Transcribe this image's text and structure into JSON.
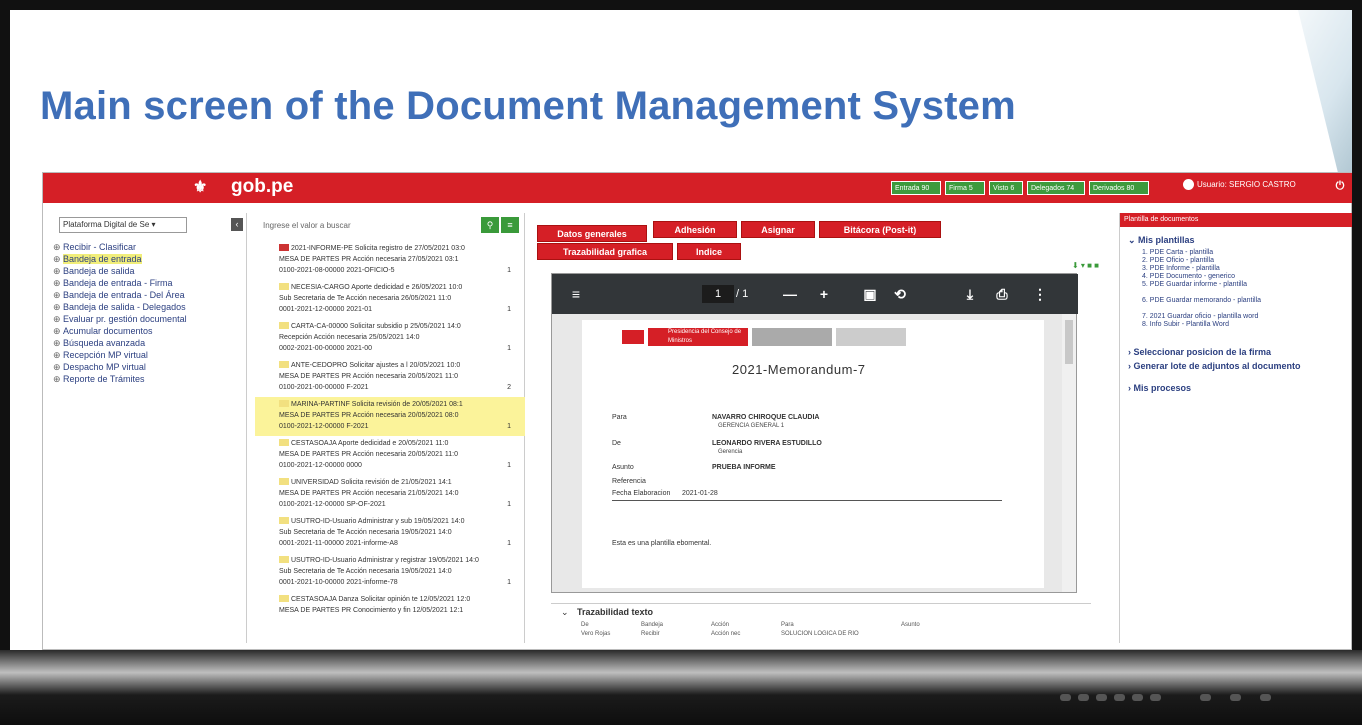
{
  "slide": {
    "headline": "Main screen of the Document Management System"
  },
  "topbar": {
    "brand": "gob.pe",
    "buttons": [
      "Entrada 90",
      "Firma 5",
      "Visto 6",
      "Delegados 74",
      "Derivados 80"
    ],
    "user": "Usuario: SERGIO CASTRO",
    "colors": {
      "bar": "#d51f26",
      "button": "#3d9a3d"
    }
  },
  "leftnav": {
    "platform_select": "Plataforma Digital de Se",
    "items": [
      "Recibir - Clasificar",
      "Bandeja de entrada",
      "Bandeja de salida",
      "Bandeja de entrada - Firma",
      "Bandeja de entrada - Del Área",
      "Bandeja de salida - Delegados",
      "Evaluar pr. gestión documental",
      "Acumular documentos",
      "Búsqueda avanzada",
      "Recepción MP virtual",
      "Despacho MP virtual",
      "Reporte de Trámites"
    ],
    "active_index": 1
  },
  "list": {
    "search_placeholder": "Ingrese el valor a buscar",
    "rows": [
      {
        "l1": "2021-INFORME-PE  Solicita registro de  27/05/2021 03:0",
        "l2": "MESA DE PARTES PR  Acción necesaria   27/05/2021 03:1",
        "l3": "0100-2021-08-00000  2021-OFICIO-5",
        "meta": "1"
      },
      {
        "l1": "NECESIA-CARGO  Aporte dedicidad e  26/05/2021 10:0",
        "l2": "Sub Secretaria de Te  Acción necesaria   26/05/2021 11:0",
        "l3": "0001-2021-12-00000  2021-01",
        "meta": "1"
      },
      {
        "l1": "CARTA-CA-00000  Solicitar subsidio p  25/05/2021 14:0",
        "l2": "Recepción   Acción necesaria   25/05/2021 14:0",
        "l3": "0002-2021-00-00000  2021-00",
        "meta": "1"
      },
      {
        "l1": "ANTE-CEDOPRO  Solicitar ajustes a l  20/05/2021 10:0",
        "l2": "MESA DE PARTES PR  Acción necesaria   20/05/2021 11:0",
        "l3": "0100-2021-00-00000  F-2021",
        "meta": "2"
      },
      {
        "l1": "MARINA-PARTINF  Solicita revisión de  20/05/2021 08:1",
        "l2": "MESA DE PARTES PR  Acción necesaria   20/05/2021 08:0",
        "l3": "0100-2021-12-00000  F-2021",
        "meta": "1"
      },
      {
        "l1": "CESTASOAJA  Aporte dedicidad e  20/05/2021 11:0",
        "l2": "MESA DE PARTES PR  Acción necesaria   20/05/2021 11:0",
        "l3": "0100-2021-12-00000  0000",
        "meta": "1"
      },
      {
        "l1": "UNIVERSIDAD  Solicita revisión de  21/05/2021 14:1",
        "l2": "MESA DE PARTES PR  Acción necesaria   21/05/2021 14:0",
        "l3": "0100-2021-12-00000  SP-OF-2021",
        "meta": "1"
      },
      {
        "l1": "USUTRO-ID-Usuario  Administrar y sub  19/05/2021 14:0",
        "l2": "Sub Secretaria de Te  Acción necesaria   19/05/2021 14:0",
        "l3": "0001-2021-11-00000  2021-informe-A8",
        "meta": "1"
      },
      {
        "l1": "USUTRO-ID-Usuario  Administrar y registrar  19/05/2021 14:0",
        "l2": "Sub Secretaria de Te  Acción necesaria   19/05/2021 14:0",
        "l3": "0001-2021-10-00000  2021-informe-78",
        "meta": "1"
      },
      {
        "l1": "CESTASOAJA Danza  Solicitar opinión te  12/05/2021 12:0",
        "l2": "MESA DE PARTES PR  Conocimiento y fin  12/05/2021 12:1",
        "l3": "",
        "meta": ""
      }
    ],
    "selected_index": 4
  },
  "center": {
    "tabs": [
      "Datos generales",
      "Adhesión",
      "Asignar",
      "Bitácora (Post-it)",
      "Trazabilidad grafica",
      "Indice"
    ],
    "viewer": {
      "page": "1",
      "total": "/ 1",
      "minus": "—",
      "plus": "+",
      "doc_title": "2021-Memorandum-7",
      "header_text": "Presidencia del Consejo de Ministros",
      "fields": [
        {
          "label": "Para",
          "value": "NAVARRO CHIROQUE CLAUDIA",
          "sub": "GERENCIA GENERAL 1"
        },
        {
          "label": "De",
          "value": "LEONARDO RIVERA ESTUDILLO",
          "sub": "Gerencia"
        },
        {
          "label": "Asunto",
          "value": "PRUEBA INFORME",
          "sub": ""
        },
        {
          "label": "Referencia",
          "value": "",
          "sub": ""
        },
        {
          "label": "Fecha Elaboracion",
          "value": "2021-01-28",
          "sub": ""
        }
      ],
      "body": "Esta es una plantilla ebomental."
    },
    "traza": {
      "title": "Trazabilidad texto",
      "cols": [
        "De",
        "Bandeja",
        "Acción",
        "Para",
        "Asunto"
      ],
      "values": [
        "Vero Rojas",
        "Recibir",
        "Acción nec",
        "SOLUCION LOGICA DE RIO",
        ""
      ]
    }
  },
  "right": {
    "header": "Plantilla de documentos",
    "section1": "Mis plantillas",
    "templates": [
      "1. PDE Carta - plantilla",
      "2. PDE Oficio - plantilla",
      "3. PDE Informe - plantilla",
      "4. PDE Documento - generico",
      "5. PDE Guardar informe - plantilla",
      "6. PDE Guardar memorando - plantilla",
      "7. 2021 Guardar oficio - plantilla word",
      "8. Info Subir - Plantilla Word"
    ],
    "sections": [
      "Seleccionar posicion de la firma",
      "Generar lote de adjuntos al documento",
      "Mis procesos"
    ]
  }
}
